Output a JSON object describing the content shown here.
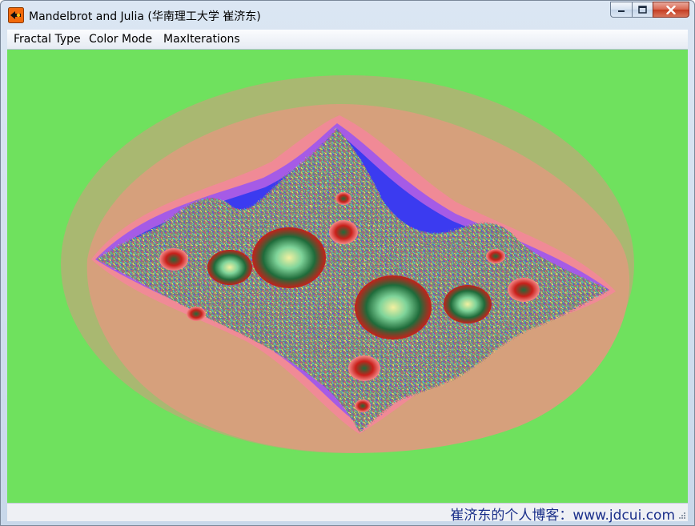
{
  "window": {
    "title": "Mandelbrot and Julia (华南理工大学 崔济东)"
  },
  "menu": {
    "items": [
      {
        "label": "Fractal Type"
      },
      {
        "label": "Color Mode"
      },
      {
        "label": "MaxIterations"
      }
    ]
  },
  "status": {
    "text": "崔济东的个人博客：www.jdcui.com"
  },
  "colors": {
    "background": "#6fe15e",
    "halo_outer": "#a9b871",
    "halo_mid": "#d6a07c",
    "halo_inner": "#f08a96",
    "band_violet": "#a55be6",
    "band_blue": "#3b3bf0",
    "core_green": "#1f6b3a",
    "core_red": "#c8201a",
    "highlight_yellow": "#f3f0a0"
  }
}
